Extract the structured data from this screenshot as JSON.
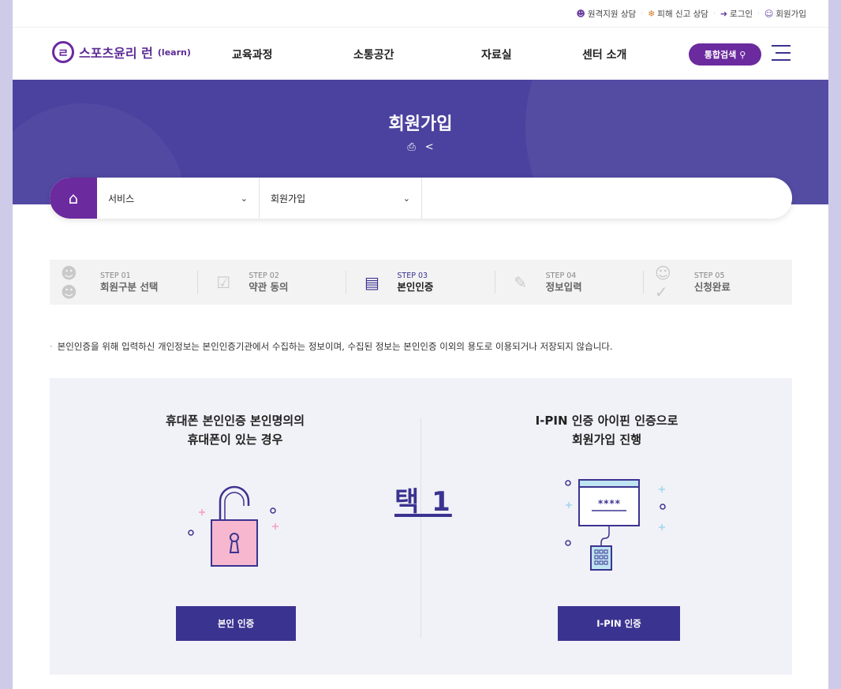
{
  "util": {
    "remote": "원격지원 상담",
    "report": "피해 신고 상담",
    "login": "로그인",
    "join": "회원가입"
  },
  "logo": {
    "text": "스포츠윤리 런",
    "sub": "(learn)"
  },
  "nav": [
    "교육과정",
    "소통공간",
    "자료실",
    "센터 소개"
  ],
  "search_label": "통합검색",
  "banner": {
    "title": "회원가입"
  },
  "breadcrumb": {
    "level1": "서비스",
    "level2": "회원가입"
  },
  "steps": [
    {
      "num": "STEP 01",
      "label": "회원구분 선택",
      "icon": "users-icon"
    },
    {
      "num": "STEP 02",
      "label": "약관 동의",
      "icon": "checklist-icon"
    },
    {
      "num": "STEP 03",
      "label": "본인인증",
      "icon": "id-card-icon",
      "active": true
    },
    {
      "num": "STEP 04",
      "label": "정보입력",
      "icon": "pencil-icon"
    },
    {
      "num": "STEP 05",
      "label": "신청완료",
      "icon": "user-check-icon"
    }
  ],
  "notice": "본인인증을 위해 입력하신 개인정보는 본인인증기관에서 수집하는 정보이며, 수집된 정보는 본인인증 이외의 용도로 이용되거나 저장되지 않습니다.",
  "phone": {
    "title_line1": "휴대폰 본인인증 본인명의의",
    "title_line2": "휴대폰이 있는 경우",
    "button": "본인 인증"
  },
  "ipin": {
    "title_line1": "I-PIN 인증 아이핀 인증으로",
    "title_line2": "회원가입 진행",
    "button": "I-PIN 인증",
    "screen_text": "****"
  },
  "overlay_text": "택 1",
  "colors": {
    "primary": "#3b3390",
    "brand": "#6b2a9e",
    "banner": "#4b429f"
  }
}
